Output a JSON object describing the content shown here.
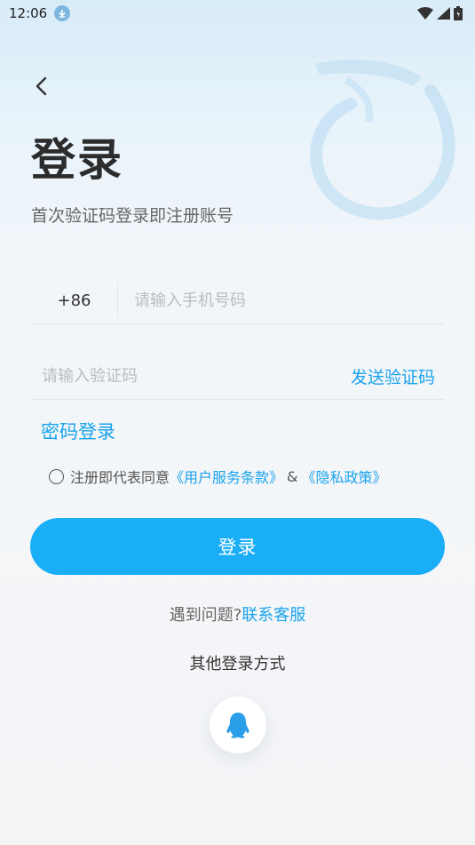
{
  "status_bar": {
    "time": "12:06"
  },
  "header": {
    "title": "登录",
    "subtitle": "首次验证码登录即注册账号"
  },
  "phone": {
    "country_code": "+86",
    "placeholder": "请输入手机号码",
    "value": ""
  },
  "code": {
    "placeholder": "请输入验证码",
    "value": "",
    "send_label": "发送验证码"
  },
  "password_login_label": "密码登录",
  "agreement": {
    "checked": false,
    "prefix": "注册即代表同意",
    "terms_link": "《用户服务条款》",
    "amp": "&",
    "privacy_link": "《隐私政策》"
  },
  "login_button_label": "登录",
  "help": {
    "question": "遇到问题?",
    "contact_link": "联系客服"
  },
  "other_login": {
    "title": "其他登录方式",
    "options": [
      {
        "icon": "qq-icon"
      }
    ]
  },
  "colors": {
    "accent": "#1aa3ec",
    "button": "#1aaef7"
  }
}
